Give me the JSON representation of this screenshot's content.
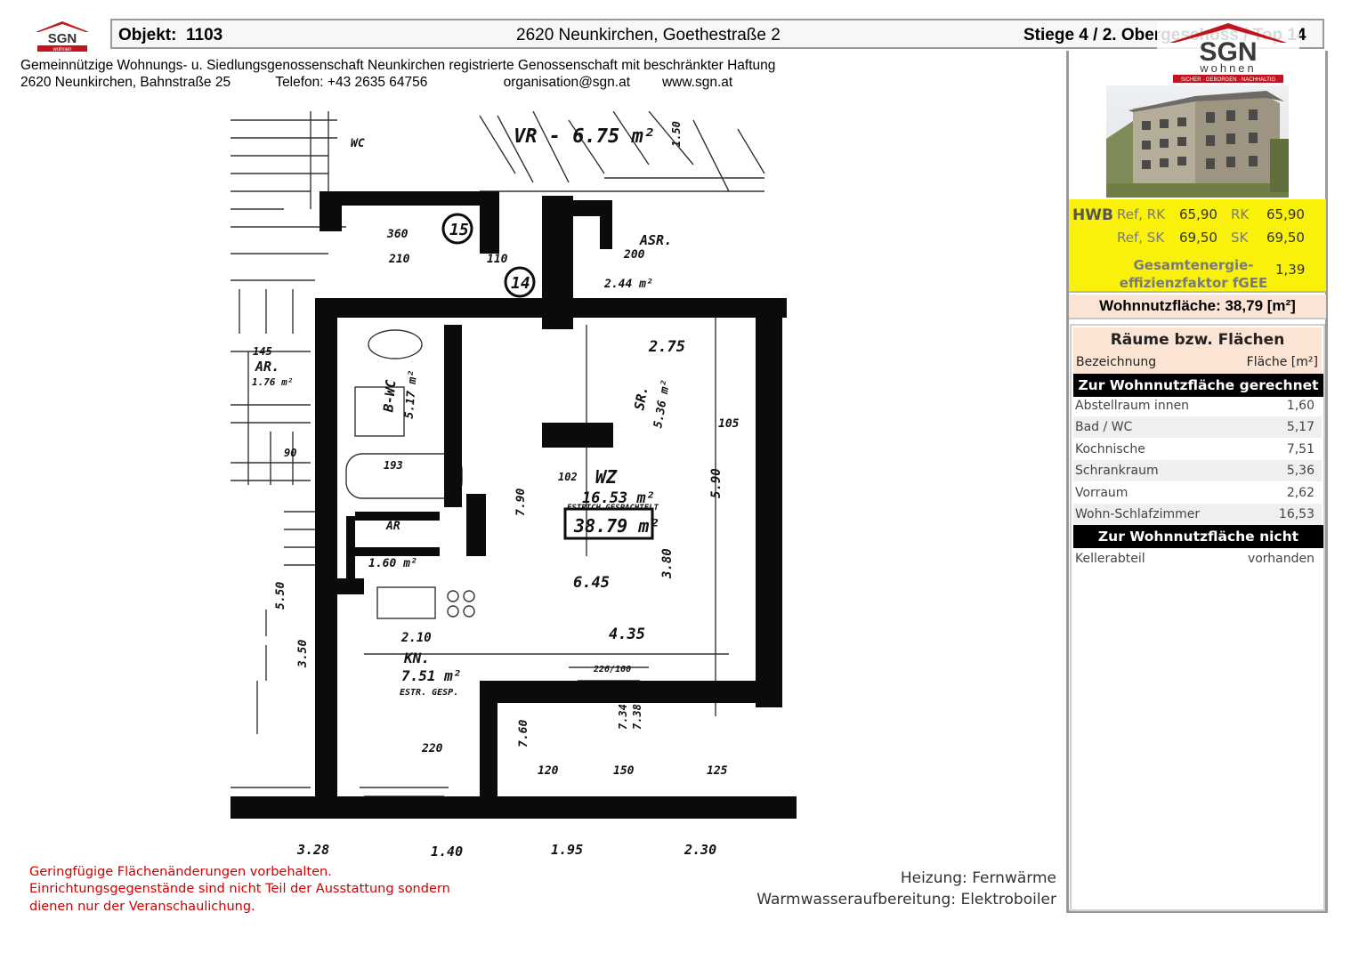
{
  "header": {
    "objekt_label": "Objekt:",
    "objekt_no": "1103",
    "address": "2620 Neunkirchen, Goethestraße 2",
    "location": "Stiege 4 / 2. Obergeschoss / Top 14"
  },
  "org": {
    "name": "Gemeinnützige Wohnungs- u. Siedlungsgenossenschaft Neunkirchen registrierte Genossenschaft mit beschränkter Haftung",
    "street": "2620 Neunkirchen, Bahnstraße 25",
    "phone": "Telefon: +43 2635 64756",
    "email": "organisation@sgn.at",
    "web": "www.sgn.at"
  },
  "logo": {
    "brand": "SGN",
    "sub": "wohnen",
    "tagline": "SICHER · GEBORGEN · NACHHALTIG"
  },
  "energy": {
    "hwb_label": "HWB",
    "ref_rk_label": "Ref, RK",
    "ref_rk_value": "65,90",
    "rk_label": "RK",
    "rk_value": "65,90",
    "ref_sk_label": "Ref, SK",
    "ref_sk_value": "69,50",
    "sk_label": "SK",
    "sk_value": "69,50",
    "fgee_label_1": "Gesamtenergie-",
    "fgee_label_2": "effizienzfaktor fGEE",
    "fgee_value": "1,39"
  },
  "wohnnutzflaeche": "Wohnnutzfläche: 38,79 [m²]",
  "rooms": {
    "title": "Räume bzw. Flächen",
    "col_name": "Bezeichnung",
    "col_area": "Fläche [m²]",
    "section_in": "Zur Wohnnutzfläche gerechnet",
    "items_in": [
      {
        "name": "Abstellraum innen",
        "area": "1,60"
      },
      {
        "name": "Bad / WC",
        "area": "5,17"
      },
      {
        "name": "Kochnische",
        "area": "7,51"
      },
      {
        "name": "Schrankraum",
        "area": "5,36"
      },
      {
        "name": "Vorraum",
        "area": "2,62"
      },
      {
        "name": "Wohn-Schlafzimmer",
        "area": "16,53"
      }
    ],
    "section_out": "Zur Wohnnutzfläche nicht gerechnet",
    "items_out": [
      {
        "name": "Kellerabteil",
        "area": "vorhanden"
      }
    ]
  },
  "plan": {
    "labels": [
      "VR - 6.75 m²",
      "WC",
      "ASR.",
      "15",
      "14",
      "2.44 m²",
      "AR.",
      "1.76 m²",
      "2.75",
      "B-WC",
      "5.17 m²",
      "SR.",
      "5.36 m²",
      "WZ",
      "16.53 m²",
      "ESTRICH GESPACHTELT",
      "38.79 m²",
      "AR",
      "1.60 m²",
      "6.45",
      "4.35",
      "KN.",
      "7.51 m²",
      "ESTR. GESP.",
      "2.10",
      "220",
      "120",
      "150",
      "125",
      "3.28",
      "1.40",
      "1.95",
      "2.30",
      "5.90",
      "3.80",
      "7.90",
      "7.60",
      "3.50",
      "5.50",
      "1.50",
      "7.34",
      "7.38",
      "145",
      "90",
      "210",
      "110",
      "360",
      "200",
      "105",
      "193",
      "102",
      "226/100"
    ]
  },
  "notes": {
    "line1": "Geringfügige Flächenänderungen vorbehalten.",
    "line2": "Einrichtungsgegenstände sind nicht Teil der Ausstattung sondern",
    "line3": "dienen nur der Veranschaulichung."
  },
  "heating": {
    "heizung": "Heizung: Fernwärme",
    "warmwasser": "Warmwasseraufbereitung: Elektroboiler"
  },
  "colors": {
    "brand_red": "#c0141e",
    "hwb_yellow": "#f9f10a",
    "peach": "#fce4d4",
    "note_red": "#d00000"
  }
}
